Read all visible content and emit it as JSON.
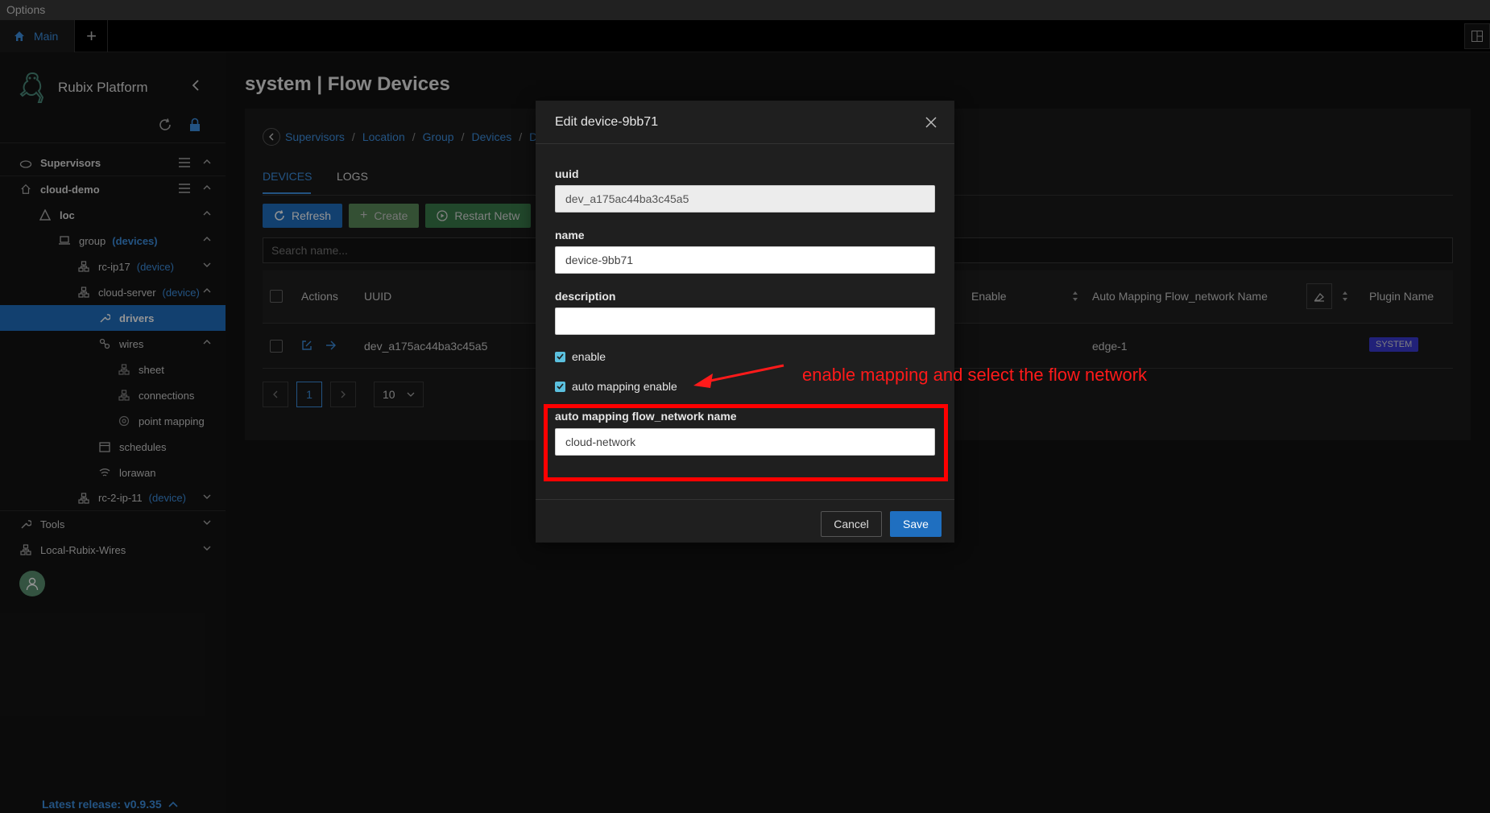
{
  "menubar": {
    "options_label": "Options"
  },
  "tabbar": {
    "main_tab": "Main",
    "add_tab": "+"
  },
  "sidebar": {
    "brand": "Rubix Platform",
    "items": [
      {
        "label": "Supervisors"
      },
      {
        "label": "cloud-demo"
      },
      {
        "label": "loc"
      },
      {
        "label": "group",
        "tag": "(devices)"
      },
      {
        "label": "rc-ip17",
        "tag": "(device)"
      },
      {
        "label": "cloud-server",
        "tag": "(device)"
      },
      {
        "label": "drivers"
      },
      {
        "label": "wires"
      },
      {
        "label": "sheet"
      },
      {
        "label": "connections"
      },
      {
        "label": "point mapping"
      },
      {
        "label": "schedules"
      },
      {
        "label": "lorawan"
      },
      {
        "label": "rc-2-ip-11",
        "tag": "(device)"
      },
      {
        "label": "Tools"
      },
      {
        "label": "Local-Rubix-Wires"
      }
    ],
    "release": "Latest release: v0.9.35"
  },
  "main": {
    "title": "system | Flow Devices",
    "breadcrumb": [
      "Supervisors",
      "Location",
      "Group",
      "Devices",
      "D"
    ],
    "tabs": [
      "DEVICES",
      "LOGS"
    ],
    "buttons": {
      "refresh": "Refresh",
      "create": "Create",
      "restart": "Restart Netw"
    },
    "search_placeholder": "Search name...",
    "table": {
      "headers": {
        "actions": "Actions",
        "uuid": "UUID",
        "enable": "Enable",
        "auto_mapping": "Auto Mapping Flow_network Name",
        "plugin": "Plugin Name"
      },
      "rows": [
        {
          "uuid": "dev_a175ac44ba3c45a5",
          "auto_mapping": "edge-1",
          "plugin": "SYSTEM"
        }
      ]
    },
    "pager": {
      "page": "1",
      "size": "10"
    }
  },
  "modal": {
    "title": "Edit device-9bb71",
    "uuid_label": "uuid",
    "uuid_value": "dev_a175ac44ba3c45a5",
    "name_label": "name",
    "name_value": "device-9bb71",
    "description_label": "description",
    "description_value": "",
    "enable_label": "enable",
    "auto_mapping_enable_label": "auto mapping enable",
    "flow_network_label": "auto mapping flow_network name",
    "flow_network_value": "cloud-network",
    "cancel": "Cancel",
    "save": "Save"
  },
  "annotation": {
    "text": "enable mapping and select the flow network",
    "color": "#ff1a1a"
  },
  "colors": {
    "accent": "#1f6fc0",
    "link": "#3d8fe0",
    "highlight": "#ff0000"
  }
}
